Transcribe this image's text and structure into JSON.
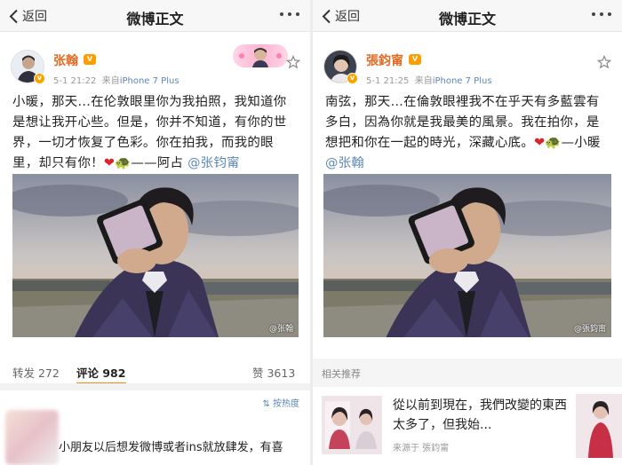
{
  "left": {
    "nav": {
      "back_label": "返回",
      "title": "微博正文"
    },
    "author": {
      "name": "张翰",
      "vip": "V",
      "verified": "v"
    },
    "meta": {
      "time": "5-1 21:22",
      "source_prefix": "来自",
      "source": "iPhone 7 Plus"
    },
    "post": {
      "text": "小暖，那天...在伦敦眼里你为我拍照，我知道你是想让我开心些。但是，你并不知道，有你的世界，一切才恢复了色彩。你在拍我，而我的眼里，却只有你！",
      "heart": "❤",
      "turtle": "🐢",
      "signoff": "——阿占",
      "mention": "@张钧甯"
    },
    "watermark": "@张翰",
    "actions": {
      "repost": "转发 272",
      "comment": "评论 982",
      "like": "赞 3613"
    },
    "sort_label": "按热度",
    "comment_text": "小朋友以后想发微博或者ins就放肆发，有喜"
  },
  "right": {
    "nav": {
      "back_label": "返回",
      "title": "微博正文"
    },
    "author": {
      "name": "張鈞甯",
      "vip": "V",
      "verified": "v"
    },
    "meta": {
      "time": "5-1 21:25",
      "source_prefix": "来自",
      "source": "iPhone 7 Plus"
    },
    "post": {
      "text": "南弦，那天…在倫敦眼裡我不在乎天有多藍雲有多白，因為你就是我最美的風景。我在拍你，是想把和你在一起的時光，深藏心底。",
      "heart": "❤",
      "turtle": "🐢",
      "signoff": "—小暖",
      "mention": "@张翰"
    },
    "watermark": "@張鈞甯",
    "recommend": {
      "header": "相关推荐",
      "title": "從以前到現在，我們改變的東西太多了，但我始...",
      "source": "来源于 張鈞甯"
    }
  },
  "colors": {
    "name": "#e26a25",
    "link": "#5d87b6",
    "vip": "#ff9c00",
    "tab_underline": "#f48b1b"
  }
}
